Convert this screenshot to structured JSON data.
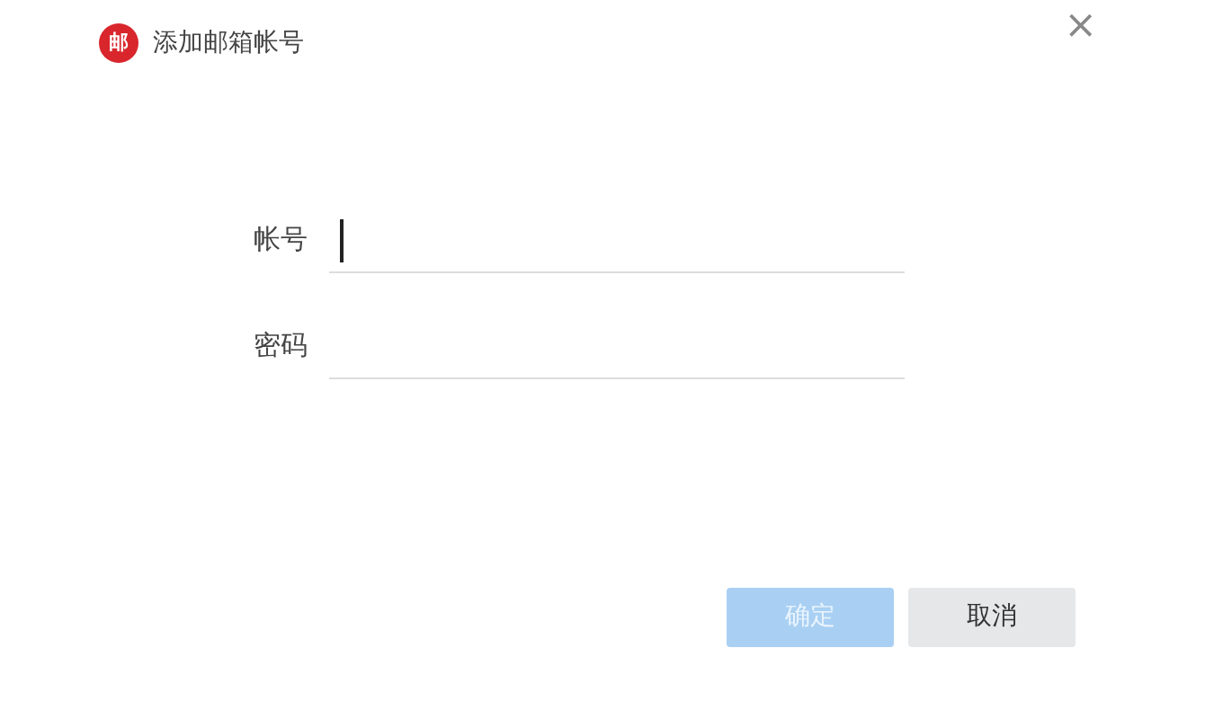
{
  "window": {
    "logo": "邮",
    "title": "添加邮箱帐号",
    "close": "×"
  },
  "fields": [
    {
      "label": "帐号",
      "focused": true
    },
    {
      "label": "密码",
      "focused": false
    }
  ],
  "buttons": [
    {
      "label": "确定",
      "disabled": true,
      "kind": "primary"
    },
    {
      "label": "取消",
      "disabled": false,
      "kind": "secondary"
    }
  ]
}
